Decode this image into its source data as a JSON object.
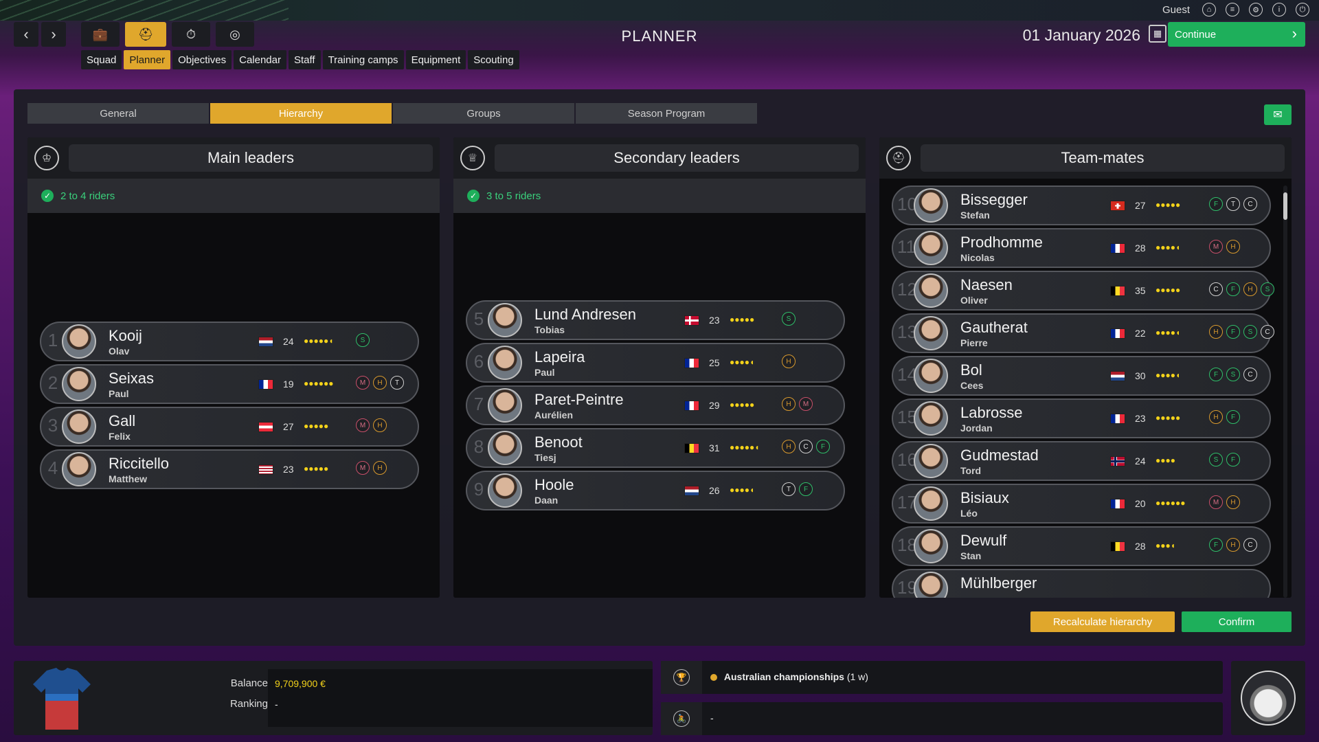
{
  "topbar": {
    "user": "Guest",
    "icons": [
      "home-icon",
      "menu-icon",
      "settings-icon",
      "info-icon",
      "power-icon"
    ]
  },
  "nav": {
    "title": "PLANNER",
    "date": "01 January 2026",
    "continue_label": "Continue",
    "main_buttons": [
      "back-icon",
      "forward-icon",
      "briefcase-icon",
      "team-icon",
      "stopwatch-icon",
      "globe-icon"
    ],
    "subtabs": [
      "Squad",
      "Planner",
      "Objectives",
      "Calendar",
      "Staff",
      "Training camps",
      "Equipment",
      "Scouting"
    ],
    "active_subtab": "Planner"
  },
  "tabs": [
    "General",
    "Hierarchy",
    "Groups",
    "Season Program"
  ],
  "active_tab": "Hierarchy",
  "columns": [
    {
      "title": "Main leaders",
      "sub": "2 to 4 riders",
      "riders": [
        {
          "num": "1",
          "last": "Kooij",
          "first": "Olav",
          "flag": "nl",
          "age": "24",
          "stars": "●●●●●◖",
          "specs": [
            "green:S"
          ]
        },
        {
          "num": "2",
          "last": "Seixas",
          "first": "Paul",
          "flag": "fr",
          "age": "19",
          "stars": "●●●●●●",
          "specs": [
            "red:M",
            "orange:H",
            "white:T"
          ]
        },
        {
          "num": "3",
          "last": "Gall",
          "first": "Felix",
          "flag": "at",
          "age": "27",
          "stars": "●●●●●",
          "specs": [
            "red:M",
            "orange:H"
          ]
        },
        {
          "num": "4",
          "last": "Riccitello",
          "first": "Matthew",
          "flag": "us",
          "age": "23",
          "stars": "●●●●●",
          "specs": [
            "red:M",
            "orange:H"
          ]
        }
      ]
    },
    {
      "title": "Secondary leaders",
      "sub": "3 to 5 riders",
      "riders": [
        {
          "num": "5",
          "last": "Lund Andresen",
          "first": "Tobias",
          "flag": "dk",
          "age": "23",
          "stars": "●●●●●",
          "specs": [
            "green:S"
          ]
        },
        {
          "num": "6",
          "last": "Lapeira",
          "first": "Paul",
          "flag": "fr",
          "age": "25",
          "stars": "●●●●◖",
          "specs": [
            "orange:H"
          ]
        },
        {
          "num": "7",
          "last": "Paret-Peintre",
          "first": "Aurélien",
          "flag": "fr",
          "age": "29",
          "stars": "●●●●●",
          "specs": [
            "orange:H",
            "red:M"
          ]
        },
        {
          "num": "8",
          "last": "Benoot",
          "first": "Tiesj",
          "flag": "be",
          "age": "31",
          "stars": "●●●●●◖",
          "specs": [
            "orange:H",
            "white:C",
            "green:F"
          ]
        },
        {
          "num": "9",
          "last": "Hoole",
          "first": "Daan",
          "flag": "nl",
          "age": "26",
          "stars": "●●●●◖",
          "specs": [
            "white:T",
            "green:F"
          ]
        }
      ]
    },
    {
      "title": "Team-mates",
      "sub": "",
      "riders": [
        {
          "num": "10",
          "last": "Bissegger",
          "first": "Stefan",
          "flag": "ch",
          "age": "27",
          "stars": "●●●●●",
          "specs": [
            "green:F",
            "white:T",
            "white:C"
          ]
        },
        {
          "num": "11",
          "last": "Prodhomme",
          "first": "Nicolas",
          "flag": "fr",
          "age": "28",
          "stars": "●●●●◖",
          "specs": [
            "red:M",
            "orange:H"
          ]
        },
        {
          "num": "12",
          "last": "Naesen",
          "first": "Oliver",
          "flag": "be",
          "age": "35",
          "stars": "●●●●●",
          "specs": [
            "white:C",
            "green:F",
            "orange:H",
            "green:S"
          ]
        },
        {
          "num": "13",
          "last": "Gautherat",
          "first": "Pierre",
          "flag": "fr",
          "age": "22",
          "stars": "●●●●◖",
          "specs": [
            "orange:H",
            "green:F",
            "green:S",
            "white:C"
          ]
        },
        {
          "num": "14",
          "last": "Bol",
          "first": "Cees",
          "flag": "nl",
          "age": "30",
          "stars": "●●●●◖",
          "specs": [
            "green:F",
            "green:S",
            "white:C"
          ]
        },
        {
          "num": "15",
          "last": "Labrosse",
          "first": "Jordan",
          "flag": "fr",
          "age": "23",
          "stars": "●●●●●",
          "specs": [
            "orange:H",
            "green:F"
          ]
        },
        {
          "num": "16",
          "last": "Gudmestad",
          "first": "Tord",
          "flag": "no",
          "age": "24",
          "stars": "●●●●",
          "specs": [
            "green:S",
            "green:F"
          ]
        },
        {
          "num": "17",
          "last": "Bisiaux",
          "first": "Léo",
          "flag": "fr",
          "age": "20",
          "stars": "●●●●●●",
          "specs": [
            "red:M",
            "orange:H"
          ]
        },
        {
          "num": "18",
          "last": "Dewulf",
          "first": "Stan",
          "flag": "be",
          "age": "28",
          "stars": "●●●◖",
          "specs": [
            "green:F",
            "orange:H",
            "white:C"
          ]
        },
        {
          "num": "19",
          "last": "Mühlberger",
          "first": "",
          "flag": "",
          "age": "",
          "stars": "",
          "specs": []
        }
      ]
    }
  ],
  "buttons": {
    "recalculate": "Recalculate hierarchy",
    "confirm": "Confirm"
  },
  "finance": {
    "balance_label": "Balance",
    "balance_value": "9,709,900 €",
    "ranking_label": "Ranking",
    "ranking_value": "-"
  },
  "events": [
    {
      "icon": "trophy-icon",
      "title": "Australian championships",
      "detail": "(1 w)"
    },
    {
      "icon": "cyclist-icon",
      "title": "-",
      "detail": ""
    }
  ],
  "colors": {
    "accent": "#e0a72c",
    "green": "#1eaf5b",
    "panel": "#1c1e24"
  }
}
